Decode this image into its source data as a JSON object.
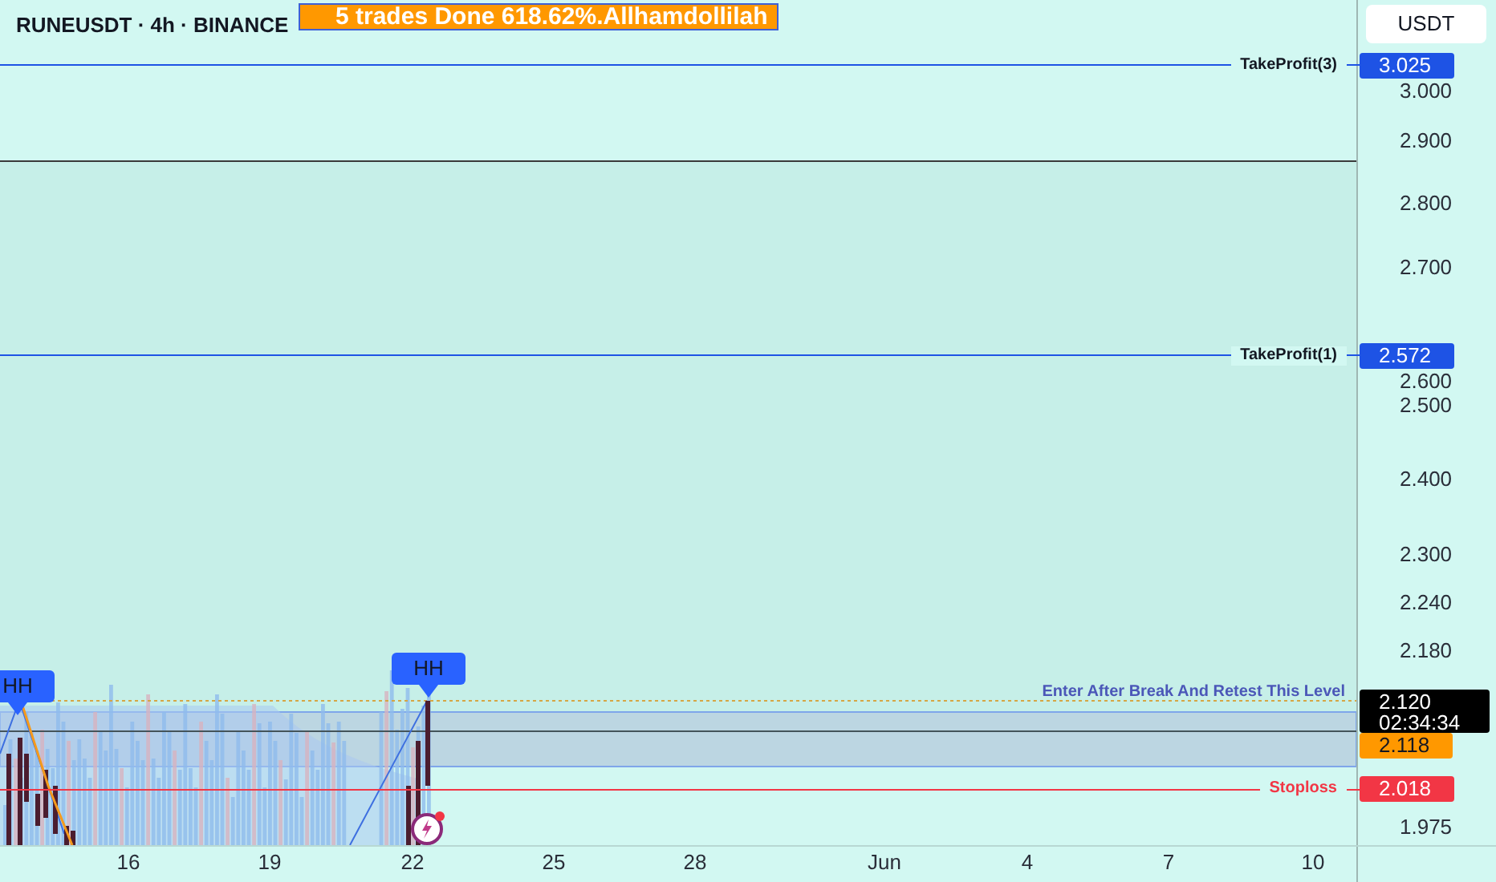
{
  "header": {
    "symbol": "RUNEUSDT · 4h · BINANCE",
    "banner": "5 trades Done 618.62%.Allhamdollilah"
  },
  "currency_button": "USDT",
  "price_axis": [
    "3.000",
    "2.900",
    "2.800",
    "2.700",
    "2.600",
    "2.500",
    "2.400",
    "2.300",
    "2.240",
    "2.180",
    "1.975"
  ],
  "time_axis": [
    "16",
    "19",
    "22",
    "25",
    "28",
    "Jun",
    "4",
    "7",
    "10"
  ],
  "levels": [
    {
      "kind": "target",
      "label": "TakeProfit(3)",
      "price": "3.025",
      "color": "#1e53e5"
    },
    {
      "kind": "target",
      "label": "TakeProfit(1)",
      "price": "2.572",
      "color": "#1e53e5"
    },
    {
      "kind": "stop",
      "label": "Stoploss",
      "price": "2.018",
      "color": "#f23645"
    }
  ],
  "entry_label": "Enter After Break And Retest This Level",
  "last_price": {
    "price": "2.120",
    "countdown": "02:34:34"
  },
  "prev_close": "2.118",
  "pattern_labels": [
    "HH",
    "HH"
  ]
}
